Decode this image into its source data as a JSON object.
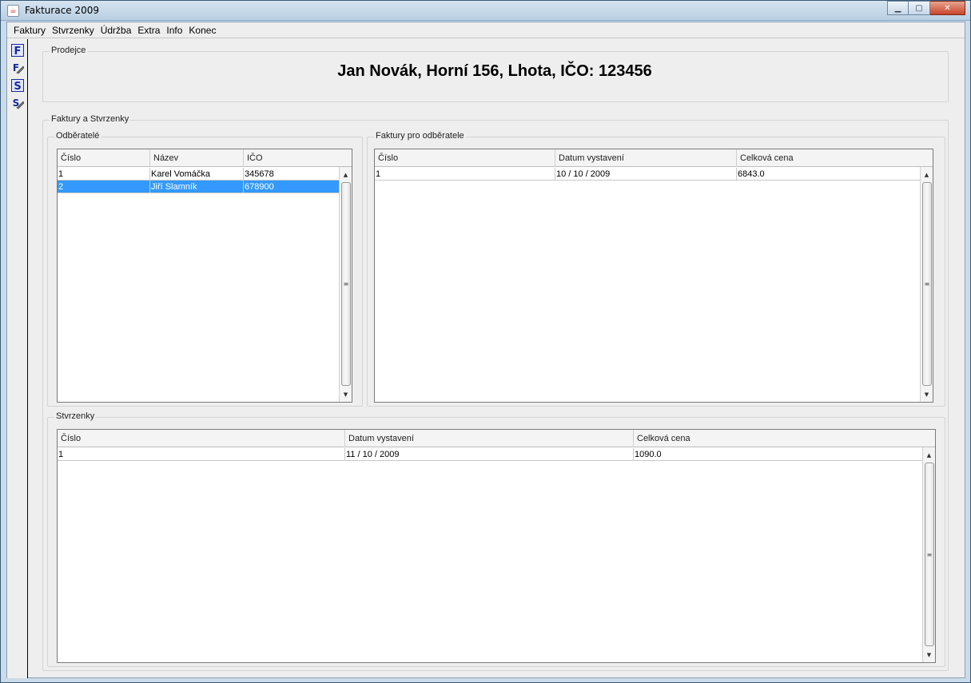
{
  "window": {
    "title": "Fakturace 2009",
    "app_icon": "java-cup-icon",
    "minimize_glyph": "▁",
    "maximize_glyph": "▢",
    "close_glyph": "✕"
  },
  "menu": {
    "items": [
      "Faktury",
      "Stvrzenky",
      "Údržba",
      "Extra",
      "Info",
      "Konec"
    ]
  },
  "toolbar": {
    "buttons": [
      {
        "icon": "new-invoice-icon",
        "glyph": "F"
      },
      {
        "icon": "edit-invoice-icon",
        "glyph": "F"
      },
      {
        "icon": "new-receipt-icon",
        "glyph": "S"
      },
      {
        "icon": "edit-receipt-icon",
        "glyph": "S"
      }
    ]
  },
  "seller": {
    "group_label": "Prodejce",
    "text": "Jan Novák, Horní 156, Lhota, IČO: 123456"
  },
  "invoices_receipts": {
    "group_label": "Faktury a Stvrzenky"
  },
  "customers": {
    "group_label": "Odběratelé",
    "columns": [
      "Číslo",
      "Název",
      "IČO"
    ],
    "rows": [
      [
        "1",
        "Karel Vomáčka",
        "345678"
      ],
      [
        "2",
        "Jiří Slamník",
        "678900"
      ]
    ],
    "selected_row": 1
  },
  "invoices": {
    "group_label": "Faktury pro odběratele",
    "columns": [
      "Číslo",
      "Datum vystavení",
      "Celková cena"
    ],
    "rows": [
      [
        "1",
        "10 / 10 / 2009",
        "6843.0"
      ]
    ]
  },
  "receipts": {
    "group_label": "Stvrzenky",
    "columns": [
      "Číslo",
      "Datum vystavení",
      "Celková cena"
    ],
    "rows": [
      [
        "1",
        "11 / 10 / 2009",
        "1090.0"
      ]
    ]
  },
  "colors": {
    "selection": "#3399ff",
    "background": "#eeeeee"
  }
}
